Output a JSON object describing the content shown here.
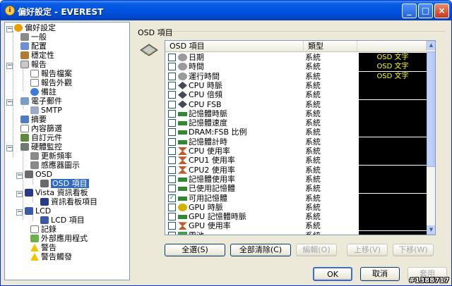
{
  "window": {
    "title": "偏好設定 - EVEREST",
    "colors": {
      "titlebar": "#0054e3",
      "selection": "#316ac5",
      "osd_bg": "#000000",
      "osd_fg": "#ffff00"
    }
  },
  "tree": {
    "items": [
      {
        "label": "偏好設定",
        "icon": "info-icon"
      },
      {
        "label": "一般",
        "icon": "gear-icon"
      },
      {
        "label": "配置",
        "icon": "config-icon"
      },
      {
        "label": "穩定性",
        "icon": "stability-icon"
      },
      {
        "label": "報告",
        "icon": "report-icon"
      },
      {
        "label": "報告檔案",
        "icon": "document-icon"
      },
      {
        "label": "報告外觀",
        "icon": "document-icon"
      },
      {
        "label": "備註",
        "icon": "info-icon"
      },
      {
        "label": "電子郵件",
        "icon": "email-icon"
      },
      {
        "label": "SMTP",
        "icon": "email-icon"
      },
      {
        "label": "摘要",
        "icon": "summary-icon"
      },
      {
        "label": "內容篩選",
        "icon": "filter-icon"
      },
      {
        "label": "自訂元件",
        "icon": "component-icon"
      },
      {
        "label": "硬體監控",
        "icon": "hardware-icon"
      },
      {
        "label": "更新頻率",
        "icon": "sensor-icon"
      },
      {
        "label": "感應器圖示",
        "icon": "sensor-icon"
      },
      {
        "label": "OSD",
        "icon": "chip-icon"
      },
      {
        "label": "OSD 項目",
        "icon": "chip-icon"
      },
      {
        "label": "Vista 資訊看板",
        "icon": "monitor-icon"
      },
      {
        "label": "資訊看板項目",
        "icon": "monitor-icon"
      },
      {
        "label": "LCD",
        "icon": "lcd-icon"
      },
      {
        "label": "LCD 項目",
        "icon": "lcd-icon"
      },
      {
        "label": "記錄",
        "icon": "log-icon"
      },
      {
        "label": "外部應用程式",
        "icon": "app-icon"
      },
      {
        "label": "警告",
        "icon": "warning-icon"
      },
      {
        "label": "警告觸發",
        "icon": "warning-icon"
      }
    ]
  },
  "osd": {
    "group_label": "OSD 項目",
    "columns": [
      "OSD 項目",
      "類型",
      ""
    ],
    "rows": [
      {
        "label": "日期",
        "type": "系統",
        "osd": "OSD 文字",
        "checked": false,
        "icon": "clock-icon"
      },
      {
        "label": "時間",
        "type": "系統",
        "osd": "OSD 文字",
        "checked": false,
        "icon": "clock-icon"
      },
      {
        "label": "運行時間",
        "type": "系統",
        "osd": "OSD 文字",
        "checked": false,
        "icon": "clock-icon"
      },
      {
        "label": "CPU 時脈",
        "type": "系統",
        "osd": "",
        "checked": false,
        "icon": "cpu-icon"
      },
      {
        "label": "CPU 倍頻",
        "type": "系統",
        "osd": "",
        "checked": false,
        "icon": "cpu-icon"
      },
      {
        "label": "CPU FSB",
        "type": "系統",
        "osd": "",
        "checked": false,
        "icon": "cpu-icon"
      },
      {
        "label": "記憶體時脈",
        "type": "系統",
        "osd": "",
        "checked": false,
        "icon": "memory-icon"
      },
      {
        "label": "記憶體速度",
        "type": "系統",
        "osd": "",
        "checked": false,
        "icon": "memory-icon"
      },
      {
        "label": "DRAM:FSB 比例",
        "type": "系統",
        "osd": "",
        "checked": false,
        "icon": "memory-icon"
      },
      {
        "label": "記憶體計時",
        "type": "系統",
        "osd": "",
        "checked": false,
        "icon": "memory-icon"
      },
      {
        "label": "CPU 使用率",
        "type": "系統",
        "osd": "",
        "checked": false,
        "icon": "hourglass-icon"
      },
      {
        "label": "CPU1 使用率",
        "type": "系統",
        "osd": "",
        "checked": false,
        "icon": "hourglass-icon"
      },
      {
        "label": "CPU2 使用率",
        "type": "系統",
        "osd": "",
        "checked": false,
        "icon": "hourglass-icon"
      },
      {
        "label": "記憶體使用率",
        "type": "系統",
        "osd": "",
        "checked": false,
        "icon": "memory-icon"
      },
      {
        "label": "已使用記憶體",
        "type": "系統",
        "osd": "",
        "checked": false,
        "icon": "memory-icon"
      },
      {
        "label": "可用記憶體",
        "type": "系統",
        "osd": "",
        "checked": true,
        "icon": "memory-icon"
      },
      {
        "label": "GPU 時脈",
        "type": "系統",
        "osd": "",
        "checked": false,
        "icon": "gpu-icon"
      },
      {
        "label": "GPU 記憶體時脈",
        "type": "系統",
        "osd": "",
        "checked": false,
        "icon": "memory-icon"
      },
      {
        "label": "GPU 使用率",
        "type": "系統",
        "osd": "",
        "checked": false,
        "icon": "hourglass-icon"
      },
      {
        "label": "電池",
        "type": "系統",
        "osd": "",
        "checked": false,
        "icon": "battery-icon"
      }
    ]
  },
  "buttons": {
    "select_all": "全選(S)",
    "clear_all": "全部清除(C)",
    "edit": "編輯(O)",
    "move_up": "上移(V)",
    "move_down": "下移(W)",
    "ok": "OK",
    "cancel": "取消",
    "apply": "套用"
  },
  "watermark": "#1388717"
}
